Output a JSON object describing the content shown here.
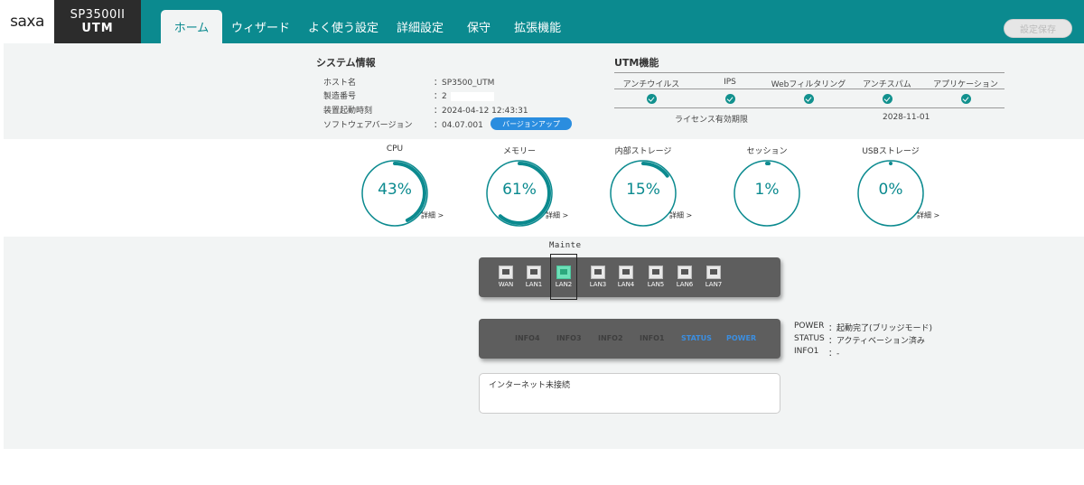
{
  "header": {
    "brand": "saxa",
    "model_line1": "SP3500II",
    "model_line2": "UTM",
    "tabs": [
      {
        "label": "ホーム",
        "active": true
      },
      {
        "label": "ウィザード",
        "active": false
      },
      {
        "label": "よく使う設定",
        "active": false
      },
      {
        "label": "詳細設定",
        "active": false
      },
      {
        "label": "保守",
        "active": false
      },
      {
        "label": "拡張機能",
        "active": false
      }
    ],
    "apply_label": "設定保存"
  },
  "system": {
    "title": "システム情報",
    "rows": [
      {
        "label": "ホスト名",
        "value": "SP3500_UTM"
      },
      {
        "label": "製造番号",
        "value": "2"
      },
      {
        "label": "装置起動時刻",
        "value": "2024-04-12 12:43:31"
      },
      {
        "label": "ソフトウェアバージョン",
        "value": "04.07.001"
      }
    ],
    "update_button": "バージョンアップ"
  },
  "utm": {
    "title": "UTM機能",
    "features": [
      "アンチウイルス",
      "IPS",
      "Webフィルタリング",
      "アンチスパム",
      "アプリケーション"
    ],
    "license_label": "ライセンス有効期限",
    "license_date": "2028-11-01"
  },
  "gauges": [
    {
      "label": "CPU",
      "value_text": "43%",
      "percent": 43,
      "detail": "詳細 >"
    },
    {
      "label": "メモリー",
      "value_text": "61%",
      "percent": 61,
      "detail": "詳細 >"
    },
    {
      "label": "内部ストレージ",
      "value_text": "15%",
      "percent": 15,
      "detail": "詳細 >"
    },
    {
      "label": "セッション",
      "value_text": "1%",
      "percent": 1,
      "detail": ""
    },
    {
      "label": "USBストレージ",
      "value_text": "0%",
      "percent": 0,
      "detail": "詳細 >"
    }
  ],
  "ports": {
    "mainte_label": "Mainte",
    "items": [
      {
        "label": "WAN",
        "active": false
      },
      {
        "label": "LAN1",
        "active": false
      },
      {
        "label": "LAN2",
        "active": true
      },
      {
        "label": "LAN3",
        "active": false
      },
      {
        "label": "LAN4",
        "active": false
      },
      {
        "label": "LAN5",
        "active": false
      },
      {
        "label": "LAN6",
        "active": false
      },
      {
        "label": "LAN7",
        "active": false
      }
    ]
  },
  "leds": [
    {
      "label": "INFO4",
      "on": false
    },
    {
      "label": "INFO3",
      "on": false
    },
    {
      "label": "INFO2",
      "on": false
    },
    {
      "label": "INFO1",
      "on": false
    },
    {
      "label": "STATUS",
      "on": true
    },
    {
      "label": "POWER",
      "on": true
    }
  ],
  "status": [
    {
      "label": "POWER",
      "value": "：起動完了(ブリッジモード)"
    },
    {
      "label": "STATUS",
      "value": "：アクティベーション済み"
    },
    {
      "label": "INFO1",
      "value": "：-"
    }
  ],
  "message": "インターネット未接続",
  "colors": {
    "accent": "#0b8a8f",
    "led_on": "#3b8ee0",
    "port_active": "#6ee0b8"
  }
}
